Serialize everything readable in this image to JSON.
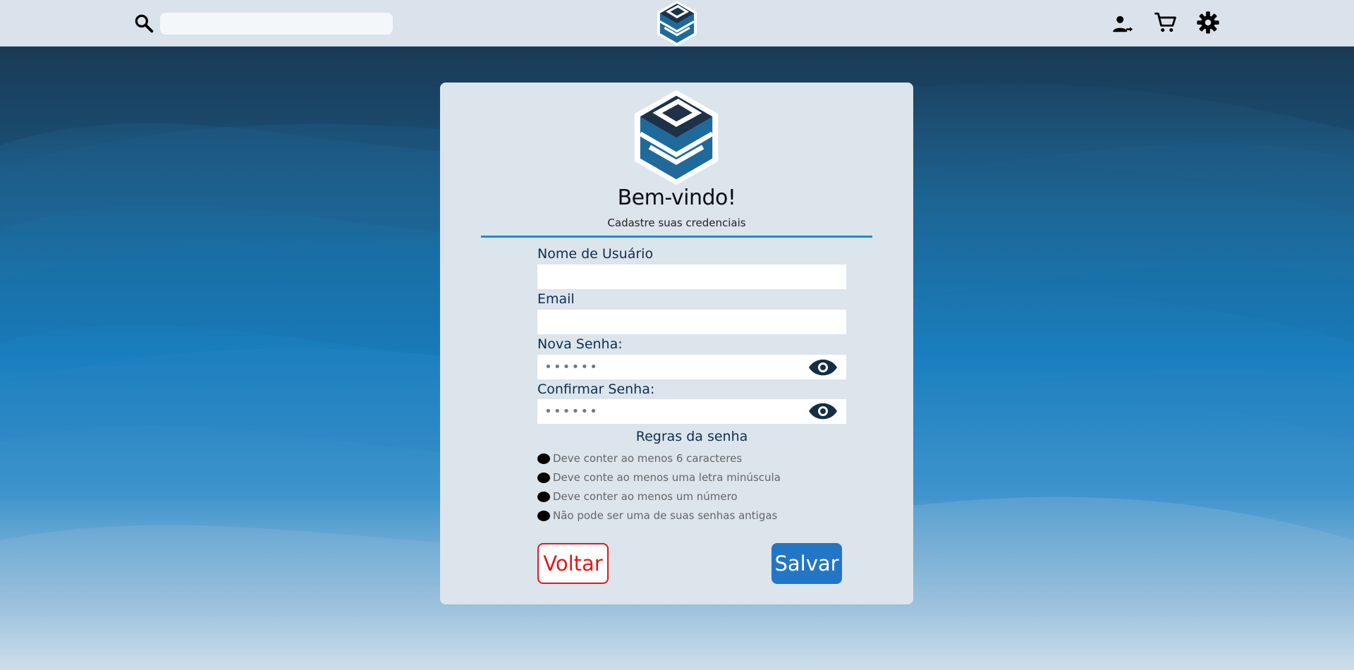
{
  "topbar": {
    "search_placeholder": "",
    "search_value": ""
  },
  "card": {
    "title": "Bem-vindo!",
    "subtitle": "Cadastre suas credenciais",
    "fields": {
      "username_label": "Nome de Usuário",
      "username_value": "",
      "email_label": "Email",
      "email_value": "",
      "new_password_label": "Nova Senha:",
      "new_password_value": "••••••",
      "confirm_password_label": "Confirmar Senha:",
      "confirm_password_value": "••••••"
    },
    "rules": {
      "title": "Regras da senha",
      "items": [
        "Deve conter ao menos 6 caracteres",
        "Deve conte ao menos uma letra minúscula",
        "Deve conter ao menos um número",
        "Não pode ser uma de suas senhas antigas"
      ]
    },
    "buttons": {
      "back_label": "Voltar",
      "save_label": "Salvar"
    }
  },
  "colors": {
    "topbar": "#dae3ec",
    "card": "#dce4ec",
    "accent": "#1f8ad1",
    "save_button": "#2376c6",
    "back_button": "#e11a1a",
    "label_text": "#0f2f4e"
  },
  "icons": [
    "search-icon",
    "brand-logo",
    "user-icon",
    "cart-icon",
    "gear-icon",
    "eye-icon"
  ]
}
